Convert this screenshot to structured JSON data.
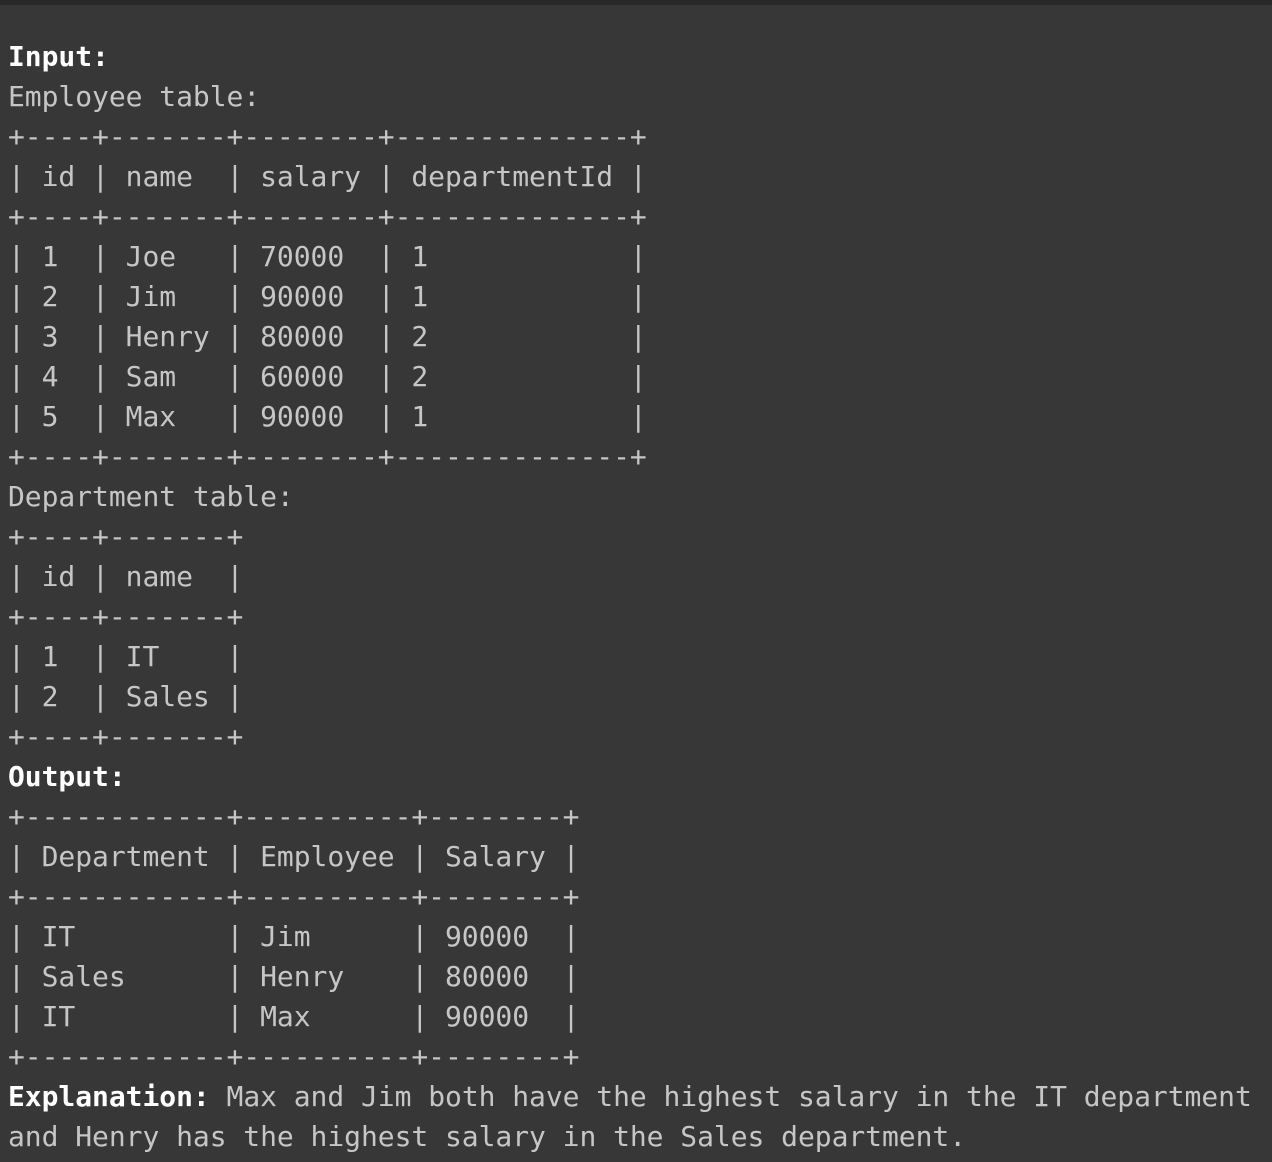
{
  "input_label": "Input:",
  "employee_table": {
    "caption": "Employee table:",
    "border": "+----+-------+--------+--------------+",
    "header": "| id | name  | salary | departmentId |",
    "columns": [
      "id",
      "name",
      "salary",
      "departmentId"
    ],
    "rows": [
      "| 1  | Joe   | 70000  | 1            |",
      "| 2  | Jim   | 90000  | 1            |",
      "| 3  | Henry | 80000  | 2            |",
      "| 4  | Sam   | 60000  | 2            |",
      "| 5  | Max   | 90000  | 1            |"
    ]
  },
  "department_table": {
    "caption": "Department table:",
    "border": "+----+-------+",
    "header": "| id | name  |",
    "columns": [
      "id",
      "name"
    ],
    "rows": [
      "| 1  | IT    |",
      "| 2  | Sales |"
    ]
  },
  "output_label": "Output:",
  "output_table": {
    "border": "+------------+----------+--------+",
    "header": "| Department | Employee | Salary |",
    "columns": [
      "Department",
      "Employee",
      "Salary"
    ],
    "rows": [
      "| IT         | Jim      | 90000  |",
      "| Sales      | Henry    | 80000  |",
      "| IT         | Max      | 90000  |"
    ]
  },
  "explanation": {
    "label": "Explanation:",
    "line1": " Max and Jim both have the highest salary in the IT department",
    "line2": "and Henry has the highest salary in the Sales department."
  }
}
